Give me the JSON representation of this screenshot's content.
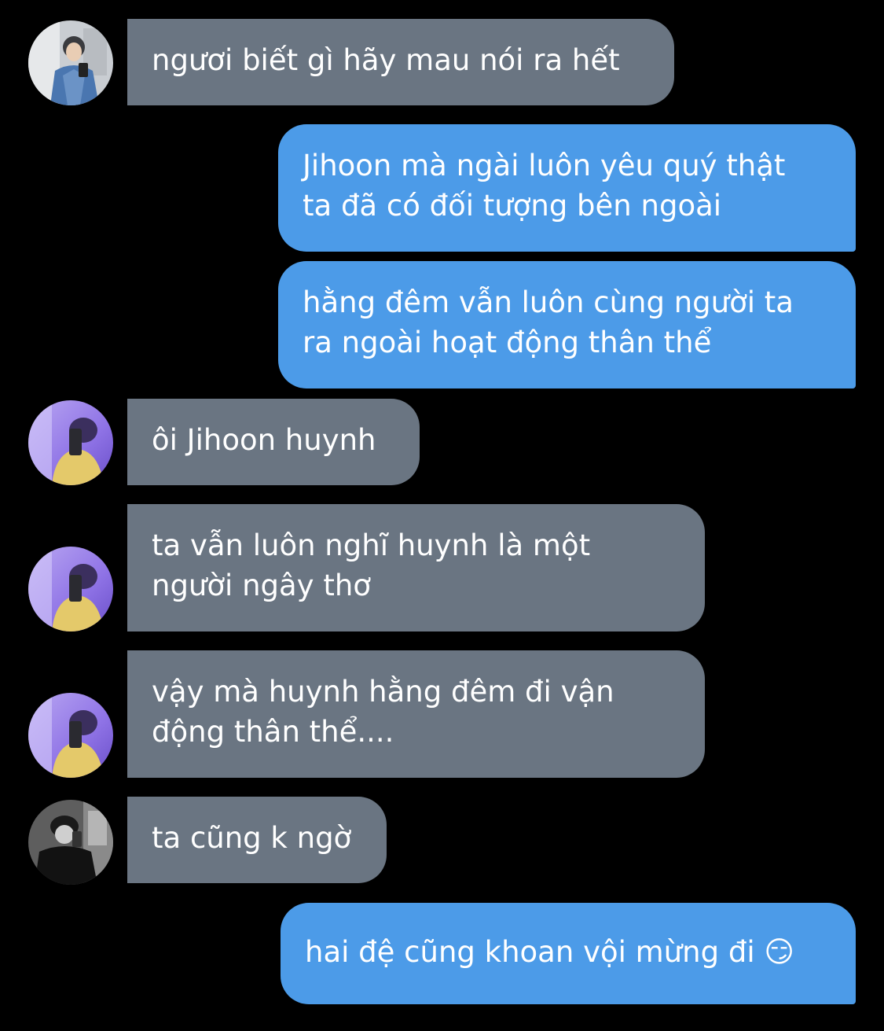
{
  "messages": [
    {
      "side": "in",
      "avatar": "avatar-gray-boy",
      "lines": [
        "ngươi biết gì hãy mau nói ra hết"
      ]
    },
    {
      "side": "out",
      "lines": [
        "Jihoon mà ngài luôn yêu quý thật",
        "ta đã có đối tượng bên ngoài"
      ]
    },
    {
      "side": "out",
      "lines": [
        "hằng đêm vẫn luôn cùng người ta",
        "ra ngoài hoạt động thân thể"
      ]
    },
    {
      "side": "in",
      "avatar": "avatar-purple-boy",
      "lines": [
        "ôi Jihoon huynh"
      ]
    },
    {
      "side": "in",
      "avatar": "avatar-purple-boy",
      "lines": [
        "ta vẫn luôn nghĩ huynh là một",
        "người ngây thơ"
      ]
    },
    {
      "side": "in",
      "avatar": "avatar-purple-boy",
      "lines": [
        "vậy mà huynh hằng đêm đi vận",
        "động thân thể...."
      ]
    },
    {
      "side": "in",
      "avatar": "avatar-bw-boy",
      "lines": [
        "ta cũng k ngờ"
      ]
    },
    {
      "side": "out",
      "lines": [
        "hai đệ cũng khoan vội mừng đi"
      ],
      "emoji": "😏"
    }
  ],
  "colors": {
    "background": "#000000",
    "incoming_bubble": "#6a7582",
    "outgoing_bubble": "#4c9be8",
    "text": "#ffffff"
  }
}
